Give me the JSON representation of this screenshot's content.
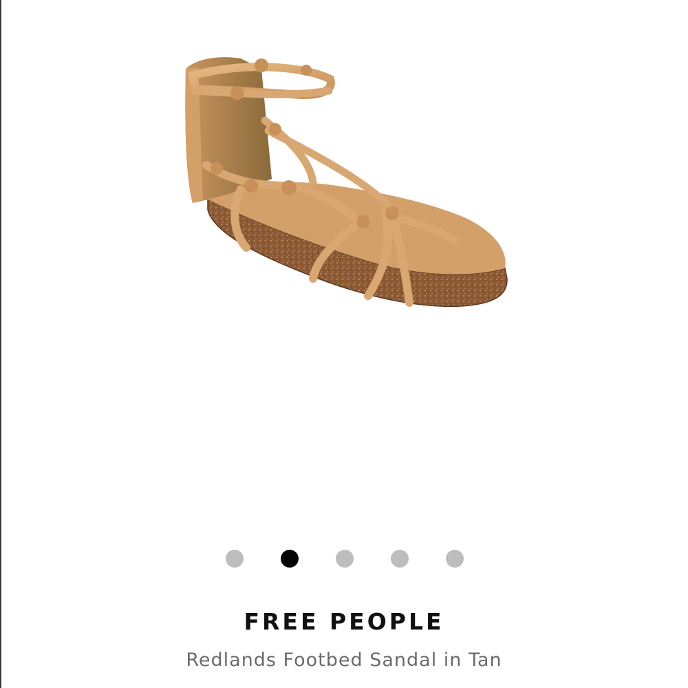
{
  "product": {
    "image_icon": "sandal-product-photo",
    "brand": "FREE PEOPLE",
    "name": "Redlands Footbed Sandal in Tan"
  },
  "carousel": {
    "count": 5,
    "active_index": 1,
    "colors": {
      "active": "#050505",
      "inactive": "#bdbdbd"
    }
  },
  "colors": {
    "leather": "#d9a772",
    "cork": "#8b5a35",
    "brand_text": "#111111",
    "name_text": "#6b6b6b"
  }
}
